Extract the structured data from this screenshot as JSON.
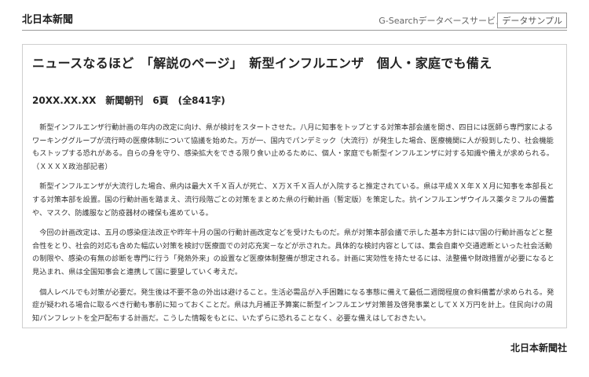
{
  "header": {
    "brand": "北日本新聞",
    "service": "G-Searchデータベースサービス",
    "sample_label": "データサンプル"
  },
  "article": {
    "title": "ニュースなるほど　「解説のページ」　新型インフルエンザ　個人・家庭でも備え",
    "meta": "20XX.XX.XX　新聞朝刊　6頁　(全841字)",
    "paragraphs": [
      "新型インフルエンザ行動計画の年内の改定に向け、県が検討をスタートさせた。八月に知事をトップとする対策本部会議を開き、四日には医師ら専門家によるワーキンググループが流行時の医療体制について協議を始めた。万が一、国内でパンデミック（大流行）が発生した場合、医療機関に人が殺到したり、社会機能もストップする恐れがある。自らの身を守り、感染拡大をできる限り食い止めるために、個人・家庭でも新型インフルエンザに対する知識や備えが求められる。　（ＸＸＸＸ政治部記者）",
      "新型インフルエンザが大流行した場合、県内は最大Ｘ千Ｘ百人が死亡、Ｘ万Ｘ千Ｘ百人が入院すると推定されている。県は平成ＸＸ年ＸＸ月に知事を本部長とする対策本部を設置。国の行動計画を踏まえ、流行段階ごとの対策をまとめた県の行動計画（暫定版）を策定した。抗インフルエンザウイルス薬タミフルの備蓄や、マスク、防護服など防疫器材の確保も進めている。",
      "今回の計画改定は、五月の感染症法改正や昨年十月の国の行動計画改定などを受けたものだ。県が対策本部会議で示した基本方針には▽国の行動計画などと整合性をとり、社会的対応も含めた幅広い対策を検討▽医療面での対応充実－などが示された。具体的な検討内容としては、集会自粛や交通遮断といった社会活動の制限や、感染の有無の診断を専門に行う「発熱外来」の設置など医療体制整備が想定される。計画に実効性を持たせるには、法整備や財政措置が必要になると見込まれ、県は全国知事会と連携して国に要望していく考えだ。",
      "個人レベルでも対策が必要だ。発生後は不要不急の外出は避けること。生活必需品が入手困難になる事態に備えて最低二週間程度の食料備蓄が求められる。発症が疑われる場合に取るべき行動も事前に知っておくことだ。県は九月補正予算案に新型インフルエンザ対策普及啓発事業としてＸＸ万円を計上。住民向けの周知パンフレットを全戸配布する計画だ。こうした情報をもとに、いたずらに恐れることなく、必要な備えはしておきたい。"
    ]
  },
  "footer": {
    "publisher": "北日本新聞社"
  }
}
